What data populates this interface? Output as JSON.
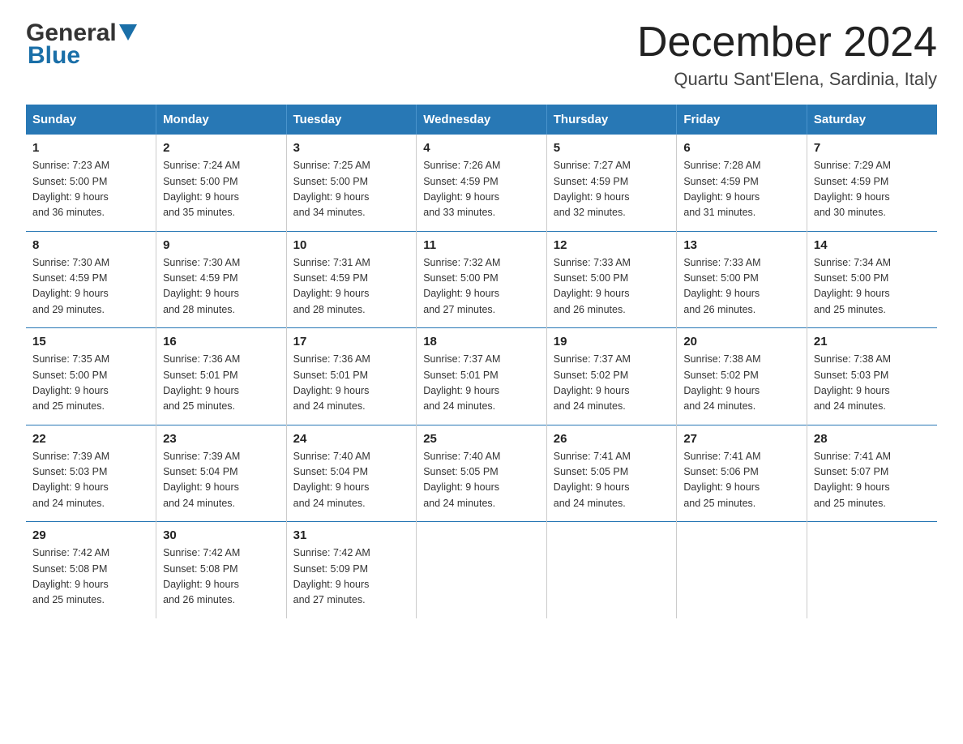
{
  "header": {
    "logo_general": "General",
    "logo_blue": "Blue",
    "month_title": "December 2024",
    "location": "Quartu Sant'Elena, Sardinia, Italy"
  },
  "calendar": {
    "days_of_week": [
      "Sunday",
      "Monday",
      "Tuesday",
      "Wednesday",
      "Thursday",
      "Friday",
      "Saturday"
    ],
    "weeks": [
      [
        {
          "day": "1",
          "sunrise": "Sunrise: 7:23 AM",
          "sunset": "Sunset: 5:00 PM",
          "daylight": "Daylight: 9 hours",
          "daylight2": "and 36 minutes."
        },
        {
          "day": "2",
          "sunrise": "Sunrise: 7:24 AM",
          "sunset": "Sunset: 5:00 PM",
          "daylight": "Daylight: 9 hours",
          "daylight2": "and 35 minutes."
        },
        {
          "day": "3",
          "sunrise": "Sunrise: 7:25 AM",
          "sunset": "Sunset: 5:00 PM",
          "daylight": "Daylight: 9 hours",
          "daylight2": "and 34 minutes."
        },
        {
          "day": "4",
          "sunrise": "Sunrise: 7:26 AM",
          "sunset": "Sunset: 4:59 PM",
          "daylight": "Daylight: 9 hours",
          "daylight2": "and 33 minutes."
        },
        {
          "day": "5",
          "sunrise": "Sunrise: 7:27 AM",
          "sunset": "Sunset: 4:59 PM",
          "daylight": "Daylight: 9 hours",
          "daylight2": "and 32 minutes."
        },
        {
          "day": "6",
          "sunrise": "Sunrise: 7:28 AM",
          "sunset": "Sunset: 4:59 PM",
          "daylight": "Daylight: 9 hours",
          "daylight2": "and 31 minutes."
        },
        {
          "day": "7",
          "sunrise": "Sunrise: 7:29 AM",
          "sunset": "Sunset: 4:59 PM",
          "daylight": "Daylight: 9 hours",
          "daylight2": "and 30 minutes."
        }
      ],
      [
        {
          "day": "8",
          "sunrise": "Sunrise: 7:30 AM",
          "sunset": "Sunset: 4:59 PM",
          "daylight": "Daylight: 9 hours",
          "daylight2": "and 29 minutes."
        },
        {
          "day": "9",
          "sunrise": "Sunrise: 7:30 AM",
          "sunset": "Sunset: 4:59 PM",
          "daylight": "Daylight: 9 hours",
          "daylight2": "and 28 minutes."
        },
        {
          "day": "10",
          "sunrise": "Sunrise: 7:31 AM",
          "sunset": "Sunset: 4:59 PM",
          "daylight": "Daylight: 9 hours",
          "daylight2": "and 28 minutes."
        },
        {
          "day": "11",
          "sunrise": "Sunrise: 7:32 AM",
          "sunset": "Sunset: 5:00 PM",
          "daylight": "Daylight: 9 hours",
          "daylight2": "and 27 minutes."
        },
        {
          "day": "12",
          "sunrise": "Sunrise: 7:33 AM",
          "sunset": "Sunset: 5:00 PM",
          "daylight": "Daylight: 9 hours",
          "daylight2": "and 26 minutes."
        },
        {
          "day": "13",
          "sunrise": "Sunrise: 7:33 AM",
          "sunset": "Sunset: 5:00 PM",
          "daylight": "Daylight: 9 hours",
          "daylight2": "and 26 minutes."
        },
        {
          "day": "14",
          "sunrise": "Sunrise: 7:34 AM",
          "sunset": "Sunset: 5:00 PM",
          "daylight": "Daylight: 9 hours",
          "daylight2": "and 25 minutes."
        }
      ],
      [
        {
          "day": "15",
          "sunrise": "Sunrise: 7:35 AM",
          "sunset": "Sunset: 5:00 PM",
          "daylight": "Daylight: 9 hours",
          "daylight2": "and 25 minutes."
        },
        {
          "day": "16",
          "sunrise": "Sunrise: 7:36 AM",
          "sunset": "Sunset: 5:01 PM",
          "daylight": "Daylight: 9 hours",
          "daylight2": "and 25 minutes."
        },
        {
          "day": "17",
          "sunrise": "Sunrise: 7:36 AM",
          "sunset": "Sunset: 5:01 PM",
          "daylight": "Daylight: 9 hours",
          "daylight2": "and 24 minutes."
        },
        {
          "day": "18",
          "sunrise": "Sunrise: 7:37 AM",
          "sunset": "Sunset: 5:01 PM",
          "daylight": "Daylight: 9 hours",
          "daylight2": "and 24 minutes."
        },
        {
          "day": "19",
          "sunrise": "Sunrise: 7:37 AM",
          "sunset": "Sunset: 5:02 PM",
          "daylight": "Daylight: 9 hours",
          "daylight2": "and 24 minutes."
        },
        {
          "day": "20",
          "sunrise": "Sunrise: 7:38 AM",
          "sunset": "Sunset: 5:02 PM",
          "daylight": "Daylight: 9 hours",
          "daylight2": "and 24 minutes."
        },
        {
          "day": "21",
          "sunrise": "Sunrise: 7:38 AM",
          "sunset": "Sunset: 5:03 PM",
          "daylight": "Daylight: 9 hours",
          "daylight2": "and 24 minutes."
        }
      ],
      [
        {
          "day": "22",
          "sunrise": "Sunrise: 7:39 AM",
          "sunset": "Sunset: 5:03 PM",
          "daylight": "Daylight: 9 hours",
          "daylight2": "and 24 minutes."
        },
        {
          "day": "23",
          "sunrise": "Sunrise: 7:39 AM",
          "sunset": "Sunset: 5:04 PM",
          "daylight": "Daylight: 9 hours",
          "daylight2": "and 24 minutes."
        },
        {
          "day": "24",
          "sunrise": "Sunrise: 7:40 AM",
          "sunset": "Sunset: 5:04 PM",
          "daylight": "Daylight: 9 hours",
          "daylight2": "and 24 minutes."
        },
        {
          "day": "25",
          "sunrise": "Sunrise: 7:40 AM",
          "sunset": "Sunset: 5:05 PM",
          "daylight": "Daylight: 9 hours",
          "daylight2": "and 24 minutes."
        },
        {
          "day": "26",
          "sunrise": "Sunrise: 7:41 AM",
          "sunset": "Sunset: 5:05 PM",
          "daylight": "Daylight: 9 hours",
          "daylight2": "and 24 minutes."
        },
        {
          "day": "27",
          "sunrise": "Sunrise: 7:41 AM",
          "sunset": "Sunset: 5:06 PM",
          "daylight": "Daylight: 9 hours",
          "daylight2": "and 25 minutes."
        },
        {
          "day": "28",
          "sunrise": "Sunrise: 7:41 AM",
          "sunset": "Sunset: 5:07 PM",
          "daylight": "Daylight: 9 hours",
          "daylight2": "and 25 minutes."
        }
      ],
      [
        {
          "day": "29",
          "sunrise": "Sunrise: 7:42 AM",
          "sunset": "Sunset: 5:08 PM",
          "daylight": "Daylight: 9 hours",
          "daylight2": "and 25 minutes."
        },
        {
          "day": "30",
          "sunrise": "Sunrise: 7:42 AM",
          "sunset": "Sunset: 5:08 PM",
          "daylight": "Daylight: 9 hours",
          "daylight2": "and 26 minutes."
        },
        {
          "day": "31",
          "sunrise": "Sunrise: 7:42 AM",
          "sunset": "Sunset: 5:09 PM",
          "daylight": "Daylight: 9 hours",
          "daylight2": "and 27 minutes."
        },
        null,
        null,
        null,
        null
      ]
    ]
  }
}
